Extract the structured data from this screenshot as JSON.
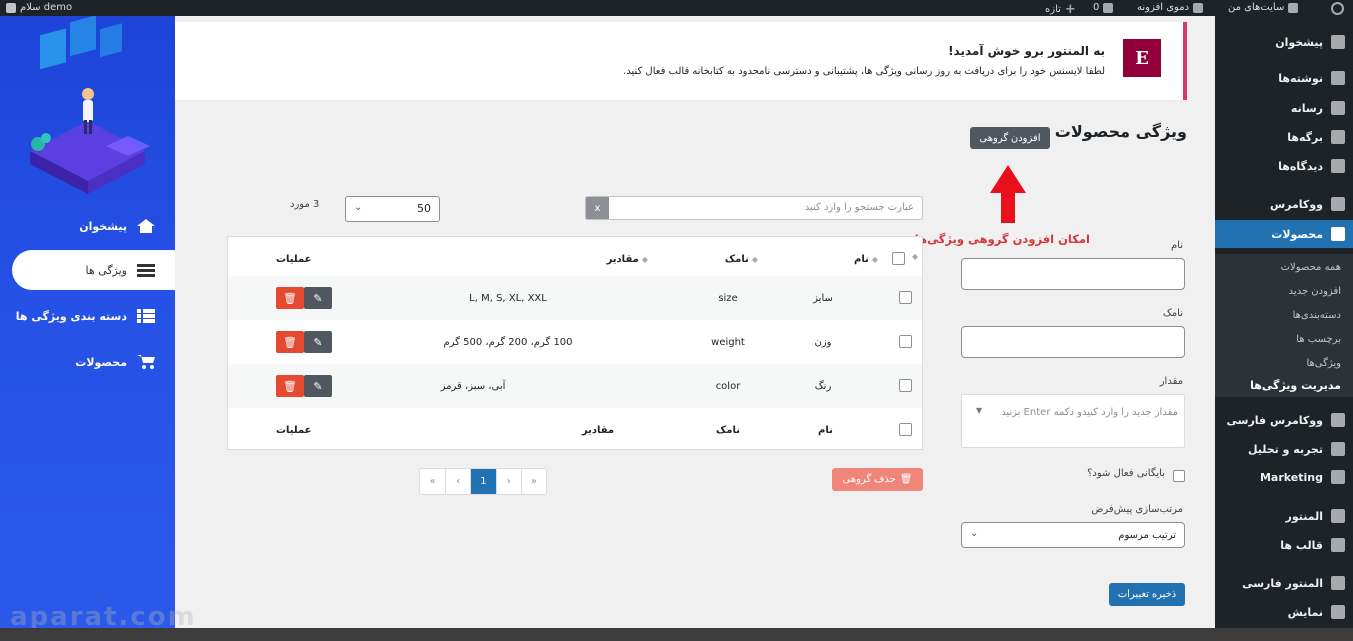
{
  "adminbar": {
    "greeting": "سلام demo",
    "my_sites": "سایت‌های من",
    "site_name": "دموی افزونه",
    "comments_count": "0",
    "new_label": "تازه"
  },
  "left_panel": {
    "items": [
      {
        "label": "پیشخوان",
        "icon": "home-icon"
      },
      {
        "label": "ویژگی ها",
        "icon": "list-icon"
      },
      {
        "label": "دسته بندی ویژگی ها",
        "icon": "grid-list-icon"
      },
      {
        "label": "محصولات",
        "icon": "cart-icon"
      }
    ]
  },
  "sidebar": {
    "items": [
      {
        "label": "پیشخوان"
      },
      {
        "label": "نوشته‌ها"
      },
      {
        "label": "رسانه"
      },
      {
        "label": "برگه‌ها"
      },
      {
        "label": "دیدگاه‌ها"
      },
      {
        "label": "ووکامرس"
      },
      {
        "label": "محصولات"
      },
      {
        "label": "ووکامرس فارسی"
      },
      {
        "label": "تجربه و تحلیل"
      },
      {
        "label": "Marketing"
      },
      {
        "label": "المنتور"
      },
      {
        "label": "قالب ها"
      },
      {
        "label": "المنتور فارسی"
      },
      {
        "label": "نمایش"
      }
    ],
    "sub_items": [
      {
        "label": "همه محصولات"
      },
      {
        "label": "افزودن جدید"
      },
      {
        "label": "دسته‌بندی‌ها"
      },
      {
        "label": "برچسب ها"
      },
      {
        "label": "ویژگی‌ها"
      },
      {
        "label": "مدیریت ویژگی‌ها"
      }
    ]
  },
  "notice": {
    "logo": "E",
    "title": "به المنتور برو خوش آمدید!",
    "text": "لطفا لایسنس خود را برای دریافت به روز رسانی ویژگی ها، پشتیبانی و دسترسی نامحدود به کتابخانه قالب فعال کنید."
  },
  "page": {
    "title": "ویژگی محصولات",
    "add_group_button": "افزودن گروهی",
    "annotation": "امکان افزودن گروهی ویژگی‌ها"
  },
  "form": {
    "name_label": "نام",
    "name_value": "",
    "slug_label": "نامک",
    "slug_value": "",
    "value_label": "مقدار",
    "value_placeholder": "مقدار جدید را وارد کنیدو دکمه Enter بزنید",
    "archive_label": "بایگانی فعال شود؟",
    "sort_label": "مرتب‌سازی پیش‌فرض",
    "sort_value": "ترتیب مرسوم",
    "save_button": "ذخیره تغییرات"
  },
  "toolbar": {
    "search_placeholder": "عبارت جستجو را وارد کنید",
    "clear": "x",
    "per_page": "50",
    "count": "3 مورد"
  },
  "table": {
    "headers": {
      "name": "نام",
      "slug": "نامک",
      "values": "مقادیر",
      "ops": "عملیات"
    },
    "rows": [
      {
        "name": "سایز",
        "slug": "size",
        "values": "L, M, S, XL, XXL"
      },
      {
        "name": "وزن",
        "slug": "weight",
        "values": "100 گرم، 200 گرم، 500 گرم"
      },
      {
        "name": "رنگ",
        "slug": "color",
        "values": "آبی، سبز، قرمز"
      }
    ]
  },
  "bulk_delete": "حذف گروهی",
  "pager": {
    "first": "«",
    "prev": "‹",
    "current": "1",
    "next": "›",
    "last": "»"
  },
  "watermark": "aparat.com"
}
